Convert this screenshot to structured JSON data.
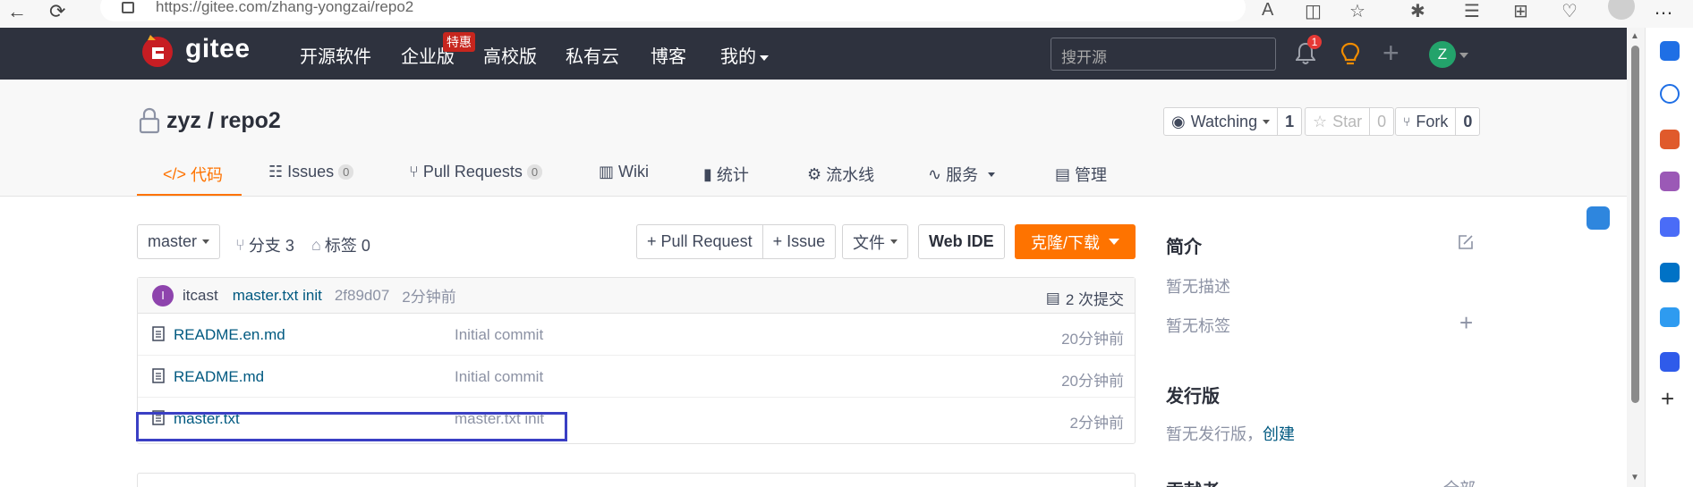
{
  "browser": {
    "url": "https://gitee.com/zhang-yongzai/repo2"
  },
  "header": {
    "logo_text": "gitee",
    "nav": [
      "开源软件",
      "企业版",
      "高校版",
      "私有云",
      "博客",
      "我的"
    ],
    "enterprise_badge": "特惠",
    "search_placeholder": "搜开源",
    "notification_count": "1",
    "user_initial": "Z"
  },
  "repo": {
    "title": "zyz / repo2",
    "watch_label": "Watching",
    "watch_count": "1",
    "star_label": "Star",
    "star_count": "0",
    "fork_label": "Fork",
    "fork_count": "0"
  },
  "tabs": [
    {
      "label": "代码",
      "icon": "code-icon"
    },
    {
      "label": "Issues",
      "count": "0",
      "icon": "issues-icon"
    },
    {
      "label": "Pull Requests",
      "count": "0",
      "icon": "pull-request-icon"
    },
    {
      "label": "Wiki",
      "icon": "wiki-icon"
    },
    {
      "label": "统计",
      "icon": "stats-icon"
    },
    {
      "label": "流水线",
      "icon": "pipeline-icon"
    },
    {
      "label": "服务",
      "icon": "service-icon"
    },
    {
      "label": "管理",
      "icon": "manage-icon"
    }
  ],
  "toolbar": {
    "branch": "master",
    "branches": "分支 3",
    "tags": "标签 0",
    "pull_request": "+ Pull Request",
    "issue": "+ Issue",
    "file": "文件",
    "web_ide": "Web IDE",
    "clone": "克隆/下载"
  },
  "commit": {
    "avatar_initial": "I",
    "author": "itcast",
    "message": "master.txt init",
    "sha": "2f89d07",
    "time": "2分钟前",
    "count_label": "2 次提交"
  },
  "files": [
    {
      "name": "README.en.md",
      "message": "Initial commit",
      "time": "20分钟前"
    },
    {
      "name": "README.md",
      "message": "Initial commit",
      "time": "20分钟前"
    },
    {
      "name": "master.txt",
      "message": "master.txt init",
      "time": "2分钟前"
    }
  ],
  "sidebar": {
    "intro_title": "简介",
    "no_desc": "暂无描述",
    "no_tags": "暂无标签",
    "release_title": "发行版",
    "no_release": "暂无发行版，",
    "create_link": "创建",
    "contributors_partial": "贡献者",
    "all_partial": "全部"
  }
}
